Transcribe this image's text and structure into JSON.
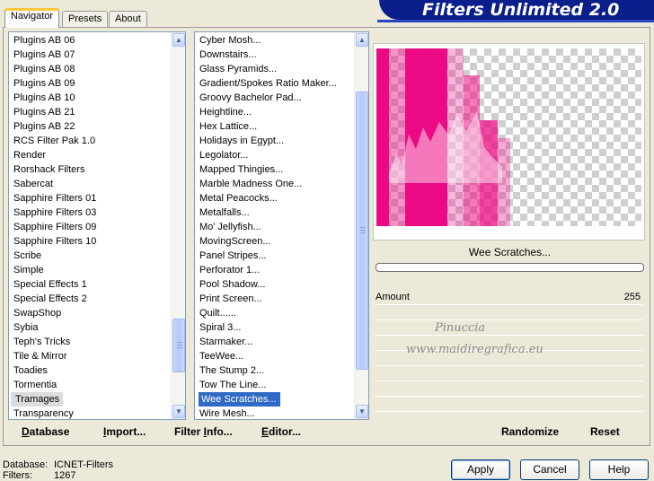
{
  "app": {
    "title": "Filters Unlimited 2.0"
  },
  "tabs": [
    {
      "label": "Navigator",
      "active": true
    },
    {
      "label": "Presets",
      "active": false
    },
    {
      "label": "About",
      "active": false
    }
  ],
  "categories": {
    "items": [
      "Plugins AB 06",
      "Plugins AB 07",
      "Plugins AB 08",
      "Plugins AB 09",
      "Plugins AB 10",
      "Plugins AB 21",
      "Plugins AB 22",
      "RCS Filter Pak 1.0",
      "Render",
      "Rorshack Filters",
      "Sabercat",
      "Sapphire Filters 01",
      "Sapphire Filters 03",
      "Sapphire Filters 09",
      "Sapphire Filters 10",
      "Scribe",
      "Simple",
      "Special Effects 1",
      "Special Effects 2",
      "SwapShop",
      "Sybia",
      "Teph's Tricks",
      "Tile & Mirror",
      "Toadies",
      "Tormentia",
      "Tramages",
      "Transparency"
    ],
    "selected": "Tramages"
  },
  "filters": {
    "items": [
      "Cyber Mosh...",
      "Downstairs...",
      "Glass Pyramids...",
      "Gradient/Spokes Ratio Maker...",
      "Groovy Bachelor Pad...",
      "Heightline...",
      "Hex Lattice...",
      "Holidays in Egypt...",
      "Legolator...",
      "Mapped Thingies...",
      "Marble Madness One...",
      "Metal Peacocks...",
      "Metalfalls...",
      "Mo' Jellyfish...",
      "MovingScreen...",
      "Panel Stripes...",
      "Perforator 1...",
      "Pool Shadow...",
      "Print Screen...",
      "Quilt......",
      "Spiral 3...",
      "Starmaker...",
      "TeeWee...",
      "The Stump 2...",
      "Tow The Line...",
      "Wee Scratches...",
      "Wire Mesh..."
    ],
    "selected": "Wee Scratches..."
  },
  "bottom_links": {
    "database": {
      "underlined": "D",
      "rest": "atabase"
    },
    "import": {
      "underlined": "I",
      "rest": "mport..."
    },
    "filter_info": {
      "pre": "Filter ",
      "underlined": "I",
      "rest": "nfo..."
    },
    "editor": {
      "underlined": "E",
      "rest": "ditor..."
    },
    "randomize": "Randomize",
    "reset": "Reset"
  },
  "preview": {
    "filter_name": "Wee Scratches...",
    "accent_color": "#ec0a84",
    "progress": 0.0
  },
  "params": [
    {
      "label": "Amount",
      "value": "255"
    }
  ],
  "watermark": {
    "line1": "Pinuccia",
    "line2": "www.maidiregrafica.eu"
  },
  "status": {
    "database_label": "Database:",
    "database_value": "ICNET-Filters",
    "filters_label": "Filters:",
    "filters_value": "1267"
  },
  "buttons": {
    "apply": "Apply",
    "cancel": "Cancel",
    "help": "Help"
  },
  "icons": {
    "scroll_up": "▲",
    "scroll_down": "▼"
  }
}
